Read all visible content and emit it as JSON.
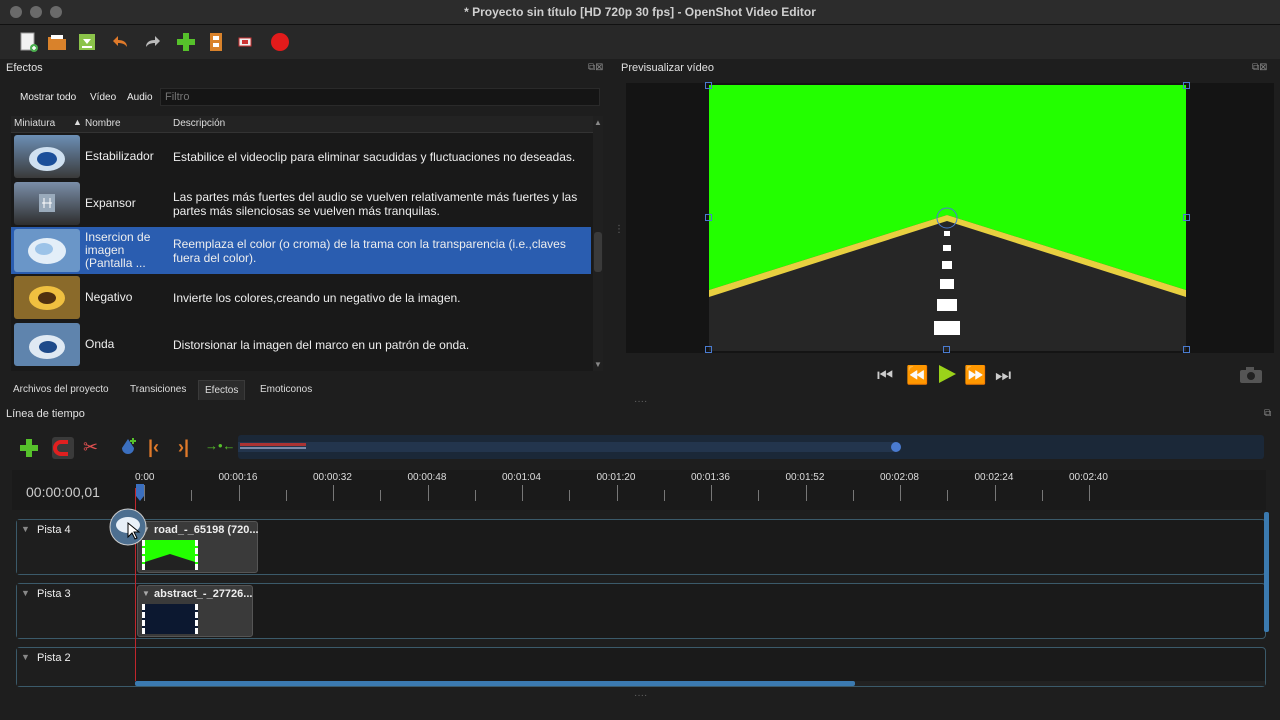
{
  "window": {
    "title": "* Proyecto sin título [HD 720p 30 fps] - OpenShot Video Editor"
  },
  "toolbar": {
    "icons": [
      "new-project-icon",
      "open-project-icon",
      "save-project-icon",
      "undo-icon",
      "redo-icon",
      "import-files-icon",
      "profile-icon",
      "fullscreen-icon",
      "export-video-icon"
    ]
  },
  "effects_panel": {
    "title": "Efectos",
    "filters": {
      "all": "Mostrar todo",
      "video": "Vídeo",
      "audio": "Audio"
    },
    "filter_placeholder": "Filtro",
    "columns": {
      "thumb": "Miniatura",
      "name": "Nombre",
      "desc": "Descripción"
    },
    "rows": [
      {
        "name": "Estabilizador",
        "desc": "Estabilice el videoclip para eliminar sacudidas y fluctuaciones no deseadas."
      },
      {
        "name": "Expansor",
        "desc": "Las partes más fuertes del audio se vuelven relativamente más fuertes y las partes más silenciosas se vuelven más tranquilas."
      },
      {
        "name": "Insercion de imagen (Pantalla ...",
        "desc": "Reemplaza el color (o croma) de la trama con la transparencia (i.e.,claves fuera del color)."
      },
      {
        "name": "Negativo",
        "desc": "Invierte los colores,creando un negativo de la imagen."
      },
      {
        "name": "Onda",
        "desc": "Distorsionar la imagen del marco en un patrón de onda."
      }
    ],
    "selected_index": 2
  },
  "bottom_tabs": {
    "project_files": "Archivos del proyecto",
    "transitions": "Transiciones",
    "effects": "Efectos",
    "emojis": "Emoticonos"
  },
  "preview": {
    "title": "Previsualizar vídeo"
  },
  "timeline": {
    "title": "Línea de tiempo",
    "timecode": "00:00:00,01",
    "ticks": [
      "0:00",
      "00:00:16",
      "00:00:32",
      "00:00:48",
      "00:01:04",
      "00:01:20",
      "00:01:36",
      "00:01:52",
      "00:02:08",
      "00:02:24",
      "00:02:40"
    ],
    "tracks": [
      {
        "name": "Pista 4",
        "clip": "road_-_65198 (720..."
      },
      {
        "name": "Pista 3",
        "clip": "abstract_-_27726..."
      },
      {
        "name": "Pista 2",
        "clip": ""
      }
    ]
  },
  "colors": {
    "selection": "#2a5db0",
    "greenscreen": "#23ff00",
    "playhead": "#c0262c"
  }
}
